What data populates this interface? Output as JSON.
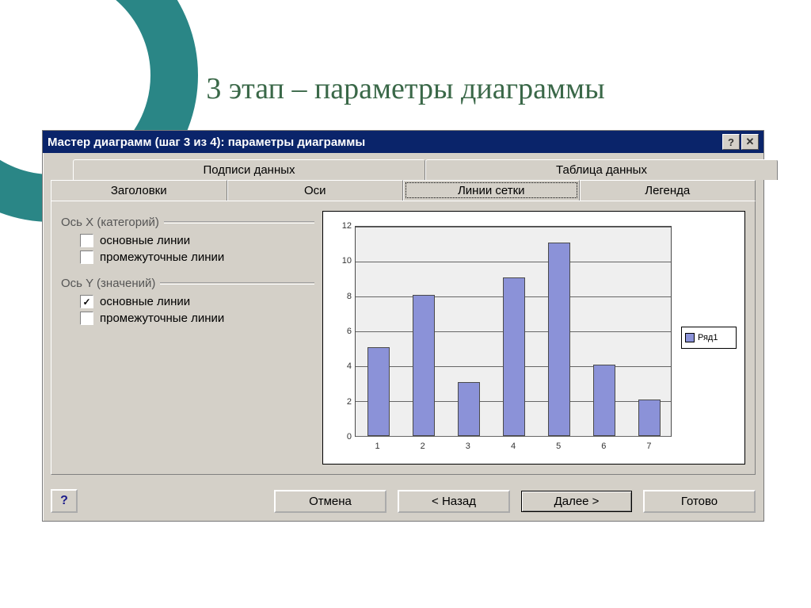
{
  "slide": {
    "title": "3 этап – параметры диаграммы"
  },
  "window": {
    "title": "Мастер диаграмм (шаг 3 из 4): параметры диаграммы"
  },
  "tabs": {
    "row1": [
      "Подписи данных",
      "Таблица данных"
    ],
    "row2": [
      "Заголовки",
      "Оси",
      "Линии сетки",
      "Легенда"
    ],
    "active": "Линии сетки"
  },
  "panel": {
    "x_group": "Ось X (категорий)",
    "y_group": "Ось Y (значений)",
    "major": "основные линии",
    "minor": "промежуточные линии",
    "x_major_checked": false,
    "x_minor_checked": false,
    "y_major_checked": true,
    "y_minor_checked": false
  },
  "chart_data": {
    "type": "bar",
    "categories": [
      "1",
      "2",
      "3",
      "4",
      "5",
      "6",
      "7"
    ],
    "values": [
      5,
      8,
      3,
      9,
      11,
      4,
      2
    ],
    "series_name": "Ряд1",
    "ylim": [
      0,
      12
    ],
    "yticks": [
      0,
      2,
      4,
      6,
      8,
      10,
      12
    ]
  },
  "buttons": {
    "help": "?",
    "cancel": "Отмена",
    "back": "< Назад",
    "next": "Далее >",
    "finish": "Готово"
  }
}
